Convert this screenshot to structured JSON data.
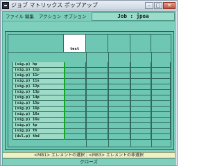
{
  "window": {
    "title": "ジョブ マトリックス ポップアップ"
  },
  "titlebar_buttons": {
    "minimize": "–",
    "maximize": "□",
    "close": "✕"
  },
  "menu": [
    {
      "label": "ファイル"
    },
    {
      "label": "編集"
    },
    {
      "label": "アクション"
    },
    {
      "label": "オプション"
    }
  ],
  "job": {
    "label": "Job : jpoa"
  },
  "grid": {
    "columns": [
      "test"
    ],
    "rows": [
      "(sig.p) hp",
      "(sig.p) 11p",
      "(sig.p) 11r",
      "(sig.p) 11s",
      "(sig.p) 12p",
      "(sig.p) 13p",
      "(sig.p) 14p",
      "(sig.p) 15p",
      "(sig.p) 16p",
      "(sig.p) 16s",
      "(sig.p) 16u",
      "(sig.p) tp",
      "(sig.p) th",
      "(dcl.p) thd"
    ]
  },
  "status_text": "<MB1> エレメントの選択 ; <MB3> エレメントの非選択",
  "close_button": "クローズ",
  "colors": {
    "background": "#7fcfbd",
    "accent": "#18a62a",
    "status": "#eef0c8"
  }
}
